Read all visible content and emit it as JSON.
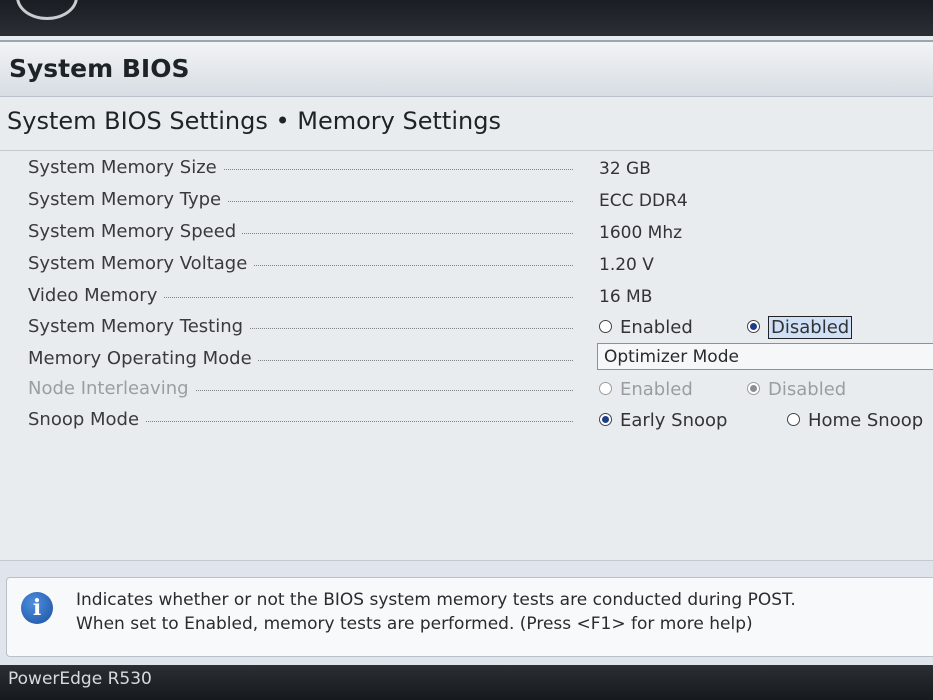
{
  "header": {
    "window_title": "System BIOS"
  },
  "page": {
    "title": "System BIOS Settings • Memory Settings"
  },
  "settings": [
    {
      "label": "System Memory Size",
      "value": "32 GB"
    },
    {
      "label": "System Memory Type",
      "value": "ECC DDR4"
    },
    {
      "label": "System Memory Speed",
      "value": "1600 Mhz"
    },
    {
      "label": "System Memory Voltage",
      "value": "1.20 V"
    },
    {
      "label": "Video Memory",
      "value": "16 MB"
    },
    {
      "label": "System Memory Testing",
      "options": [
        "Enabled",
        "Disabled"
      ],
      "selected": "Disabled"
    },
    {
      "label": "Memory Operating Mode",
      "value": "Optimizer Mode"
    },
    {
      "label": "Node Interleaving",
      "options": [
        "Enabled",
        "Disabled"
      ],
      "selected": "Disabled",
      "disabled": true
    },
    {
      "label": "Snoop Mode",
      "options": [
        "Early Snoop",
        "Home Snoop"
      ],
      "selected": "Early Snoop"
    }
  ],
  "help": {
    "icon": "info-icon",
    "line1": "Indicates whether or not the BIOS system memory tests are conducted during POST.",
    "line2": "When set to Enabled, memory tests are performed. (Press <F1> for more help)"
  },
  "footer": {
    "model": "PowerEdge R530"
  },
  "colors": {
    "accent": "#1f3e8a",
    "background": "#e8ecef",
    "topbar": "#1a1d22"
  }
}
